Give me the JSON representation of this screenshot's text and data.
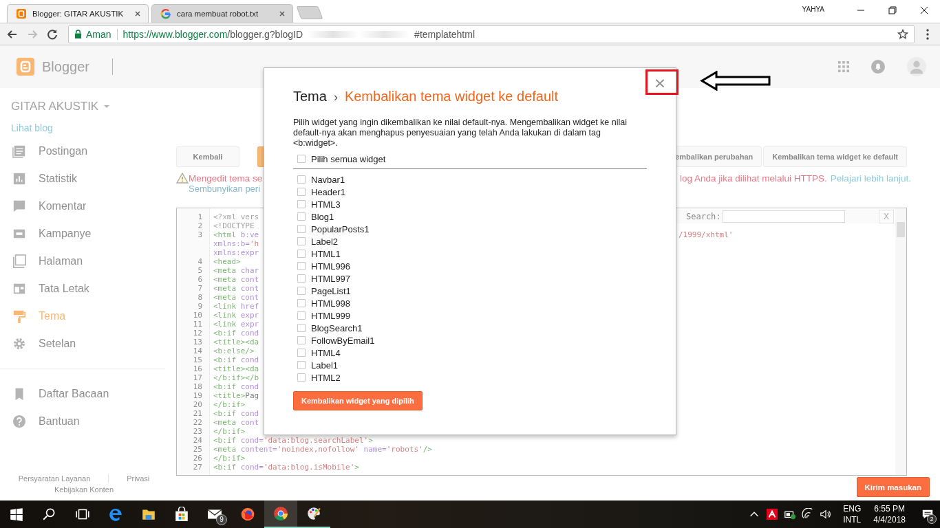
{
  "browser": {
    "tabs": [
      {
        "title": "Blogger: GITAR AKUSTIK",
        "selected": true
      },
      {
        "title": "cara membuat robot.txt",
        "selected": false
      }
    ],
    "profile": "YAHYA",
    "security_label": "Aman",
    "url_host": "https://www.blogger.com",
    "url_path": "/blogger.g?blogID",
    "url_end": "#templatehtml"
  },
  "header": {
    "logo_text": "Blogger"
  },
  "sidebar": {
    "blog_title": "GITAR AKUSTIK",
    "view_link": "Lihat blog",
    "items": [
      {
        "label": "Postingan",
        "selected": false
      },
      {
        "label": "Statistik",
        "selected": false
      },
      {
        "label": "Komentar",
        "selected": false
      },
      {
        "label": "Kampanye",
        "selected": false
      },
      {
        "label": "Halaman",
        "selected": false
      },
      {
        "label": "Tata Letak",
        "selected": false
      },
      {
        "label": "Tema",
        "selected": true
      },
      {
        "label": "Setelan",
        "selected": false
      }
    ],
    "secondary_items": [
      {
        "label": "Daftar Bacaan",
        "selected": false
      },
      {
        "label": "Bantuan",
        "selected": false
      }
    ],
    "footer_links": [
      "Persyaratan Layanan",
      "Privasi",
      "Kebijakan Konten"
    ]
  },
  "toolbar": {
    "left_buttons": [
      {
        "kind": "plain",
        "label": "Kembali"
      },
      {
        "kind": "primary"
      }
    ],
    "right_buttons": [
      {
        "kind": "plain",
        "label": "embalikan perubahan"
      },
      {
        "kind": "plain",
        "label": "Kembalikan tema widget ke default"
      }
    ]
  },
  "notice": {
    "text_start": "Mengedit tema se",
    "text_end": "log Anda jika dilihat melalui HTTPS.",
    "link": "Pelajari lebih lanjut.",
    "hide_link": "Sembunyikan peri"
  },
  "editor": {
    "search_label": "Search:",
    "clear_button": "X",
    "lines": [
      {
        "number": "1",
        "tokens": [
          {
            "kind": "meta",
            "text": "<?xml vers"
          }
        ]
      },
      {
        "number": "2",
        "tokens": [
          {
            "kind": "meta",
            "text": "<!DOCTYPE"
          }
        ]
      },
      {
        "number": "3",
        "tokens": [
          {
            "kind": "tag",
            "text": "<html"
          },
          {
            "kind": "attr",
            "text": " b:ve"
          }
        ],
        "tail": "/1999/xhtml'"
      },
      {
        "tokens": [
          {
            "kind": "attr",
            "text": "xmlns:b="
          },
          {
            "kind": "str",
            "text": "'h"
          }
        ]
      },
      {
        "tokens": [
          {
            "kind": "attr",
            "text": "xmlns:expr"
          }
        ]
      },
      {
        "number": "4",
        "tokens": [
          {
            "kind": "tag",
            "text": "<head>"
          }
        ]
      },
      {
        "number": "5",
        "tokens": [
          {
            "kind": "tag",
            "text": "<meta"
          },
          {
            "kind": "attr",
            "text": " char"
          }
        ]
      },
      {
        "number": "6",
        "tokens": [
          {
            "kind": "tag",
            "text": "<meta"
          },
          {
            "kind": "attr",
            "text": " cont"
          }
        ]
      },
      {
        "number": "7",
        "tokens": [
          {
            "kind": "tag",
            "text": "<meta"
          },
          {
            "kind": "attr",
            "text": " cont"
          }
        ]
      },
      {
        "number": "8",
        "tokens": [
          {
            "kind": "tag",
            "text": "<meta"
          },
          {
            "kind": "attr",
            "text": " cont"
          }
        ]
      },
      {
        "number": "9",
        "tokens": [
          {
            "kind": "tag",
            "text": "<link"
          },
          {
            "kind": "attr",
            "text": " href"
          }
        ]
      },
      {
        "number": "10",
        "tokens": [
          {
            "kind": "tag",
            "text": "<link"
          },
          {
            "kind": "attr",
            "text": " expr"
          }
        ]
      },
      {
        "number": "11",
        "tokens": [
          {
            "kind": "tag",
            "text": "<link"
          },
          {
            "kind": "attr",
            "text": " expr"
          }
        ]
      },
      {
        "number": "12",
        "tokens": [
          {
            "kind": "tag",
            "text": "<b:if"
          },
          {
            "kind": "attr",
            "text": " cond"
          }
        ]
      },
      {
        "number": "13",
        "tokens": [
          {
            "kind": "tag",
            "text": "<title><da"
          }
        ]
      },
      {
        "number": "14",
        "tokens": [
          {
            "kind": "tag",
            "text": "<b:else/>"
          }
        ]
      },
      {
        "number": "15",
        "tokens": [
          {
            "kind": "tag",
            "text": "<b:if"
          },
          {
            "kind": "attr",
            "text": " cond"
          }
        ]
      },
      {
        "number": "16",
        "tokens": [
          {
            "kind": "tag",
            "text": "<title><da"
          }
        ]
      },
      {
        "number": "17",
        "tokens": [
          {
            "kind": "tag",
            "text": "</b:if></b"
          }
        ]
      },
      {
        "number": "18",
        "tokens": [
          {
            "kind": "tag",
            "text": "<b:if"
          },
          {
            "kind": "attr",
            "text": " cond"
          }
        ]
      },
      {
        "number": "19",
        "tokens": [
          {
            "kind": "tag",
            "text": "<title>"
          },
          {
            "kind": "plain",
            "text": "Pag"
          }
        ]
      },
      {
        "number": "20",
        "tokens": [
          {
            "kind": "tag",
            "text": "</b:if>"
          }
        ]
      },
      {
        "number": "21",
        "tokens": [
          {
            "kind": "tag",
            "text": "<b:if"
          },
          {
            "kind": "attr",
            "text": " cond"
          }
        ]
      },
      {
        "number": "22",
        "tokens": [
          {
            "kind": "tag",
            "text": "<meta"
          },
          {
            "kind": "attr",
            "text": " cont"
          }
        ]
      },
      {
        "number": "23",
        "tokens": [
          {
            "kind": "tag",
            "text": "</b:if>"
          }
        ]
      },
      {
        "number": "24",
        "tokens": [
          {
            "kind": "tag",
            "text": "<b:if"
          },
          {
            "kind": "attr",
            "text": " cond="
          },
          {
            "kind": "str",
            "text": "'data:blog.searchLabel'"
          },
          {
            "kind": "tag",
            "text": ">"
          }
        ]
      },
      {
        "number": "25",
        "tokens": [
          {
            "kind": "tag",
            "text": "<meta"
          },
          {
            "kind": "attr",
            "text": " content="
          },
          {
            "kind": "str",
            "text": "'noindex,nofollow'"
          },
          {
            "kind": "attr",
            "text": " name="
          },
          {
            "kind": "str",
            "text": "'robots'"
          },
          {
            "kind": "tag",
            "text": "/>"
          }
        ]
      },
      {
        "number": "26",
        "tokens": [
          {
            "kind": "tag",
            "text": "</b:if>"
          }
        ]
      },
      {
        "number": "27",
        "tokens": [
          {
            "kind": "tag",
            "text": "<b:if"
          },
          {
            "kind": "attr",
            "text": " cond="
          },
          {
            "kind": "str",
            "text": "'data:blog.isMobile'"
          },
          {
            "kind": "tag",
            "text": ">"
          }
        ]
      }
    ]
  },
  "dialog": {
    "breadcrumb": "Tema",
    "separator": "›",
    "title": "Kembalikan tema widget ke default",
    "close": "×",
    "description": "Pilih widget yang ingin dikembalikan ke nilai default-nya. Mengembalikan widget ke nilai default-nya akan menghapus penyesuaian yang telah Anda lakukan di dalam tag <b:widget>.",
    "select_all": {
      "label": "Pilih semua widget",
      "checked": false
    },
    "widgets": [
      {
        "label": "Navbar1",
        "checked": false
      },
      {
        "label": "Header1",
        "checked": false
      },
      {
        "label": "HTML3",
        "checked": false
      },
      {
        "label": "Blog1",
        "checked": false
      },
      {
        "label": "PopularPosts1",
        "checked": false
      },
      {
        "label": "Label2",
        "checked": false
      },
      {
        "label": "HTML1",
        "checked": false
      },
      {
        "label": "HTML996",
        "checked": false
      },
      {
        "label": "HTML997",
        "checked": false
      },
      {
        "label": "PageList1",
        "checked": false
      },
      {
        "label": "HTML998",
        "checked": false
      },
      {
        "label": "HTML999",
        "checked": false
      },
      {
        "label": "BlogSearch1",
        "checked": false
      },
      {
        "label": "FollowByEmail1",
        "checked": false
      },
      {
        "label": "HTML4",
        "checked": false
      },
      {
        "label": "Label1",
        "checked": false
      },
      {
        "label": "HTML2",
        "checked": false
      }
    ],
    "submit": "Kembalikan widget yang dipilih"
  },
  "feedback_button": "Kirim masukan",
  "taskbar": {
    "apps": [
      {
        "kind": "start",
        "running": false,
        "selected": false
      },
      {
        "kind": "search",
        "running": false,
        "selected": false
      },
      {
        "kind": "taskview",
        "running": false,
        "selected": false
      },
      {
        "kind": "edge",
        "running": false,
        "selected": false
      },
      {
        "kind": "explorer",
        "running": false,
        "selected": false
      },
      {
        "kind": "store",
        "running": false,
        "selected": false
      },
      {
        "kind": "mail",
        "running": false,
        "selected": false,
        "badge": "9"
      },
      {
        "kind": "firefox",
        "running": false,
        "selected": false
      },
      {
        "kind": "chrome",
        "running": true,
        "selected": true
      },
      {
        "kind": "paint",
        "running": true,
        "selected": false
      }
    ],
    "tray_icons": [
      {
        "kind": "caret"
      },
      {
        "kind": "antivirus"
      },
      {
        "kind": "battery"
      },
      {
        "kind": "wifi"
      },
      {
        "kind": "volume"
      }
    ],
    "language": "ENG",
    "layout": "INTL",
    "time": "6:55 PM",
    "date": "4/4/2018",
    "notifications": "2"
  }
}
